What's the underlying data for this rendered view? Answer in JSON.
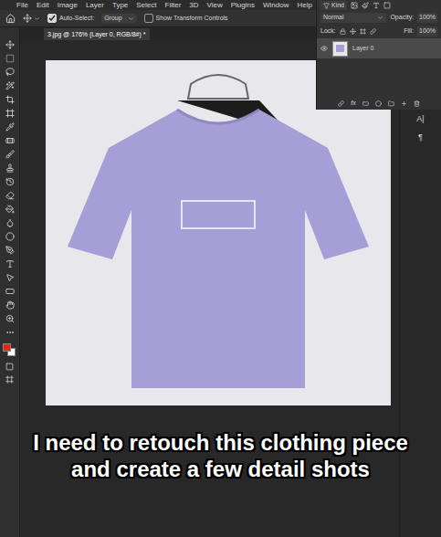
{
  "menu": [
    "File",
    "Edit",
    "Image",
    "Layer",
    "Type",
    "Select",
    "Filter",
    "3D",
    "View",
    "Plugins",
    "Window",
    "Help"
  ],
  "options": {
    "auto_select": {
      "label": "Auto-Select:",
      "checked": true
    },
    "group": "Group",
    "transform": {
      "label": "Show Transform Controls",
      "checked": false
    }
  },
  "document_tab": {
    "title": "3.jpg @ 176% (Layer 0, RGB/8#) *"
  },
  "layers_panel": {
    "filter": "Kind",
    "blend": "Normal",
    "opacity_label": "Opacity:",
    "opacity": "100%",
    "lock_label": "Lock:",
    "fill_label": "Fill:",
    "fill": "100%",
    "layers": [
      {
        "name": "Layer 0",
        "visible": true,
        "selected": true
      }
    ]
  },
  "right_strip": [
    "A|",
    "¶"
  ],
  "swatches": [
    {
      "name": "foreground",
      "color": "#e8231a"
    },
    {
      "name": "background",
      "color": "#ffffff"
    }
  ],
  "subtitle": "I need to retouch this clothing piece and create a few detail shots"
}
